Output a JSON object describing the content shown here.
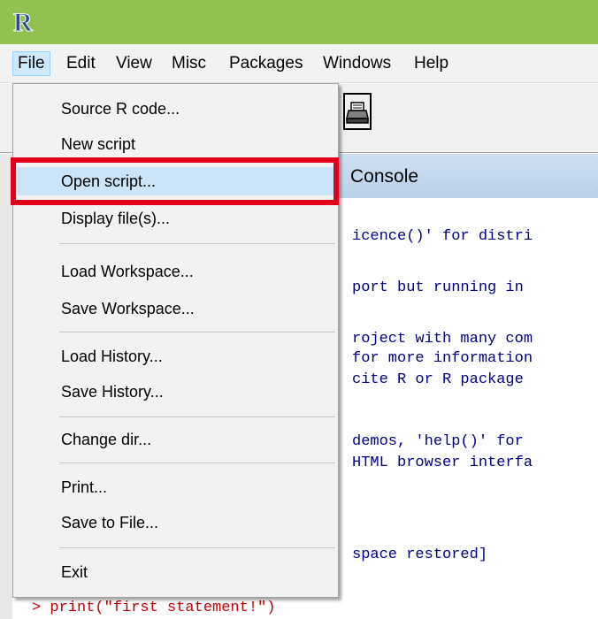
{
  "app": {
    "logo_letter": "R"
  },
  "menubar": {
    "items": [
      "File",
      "Edit",
      "View",
      "Misc",
      "Packages",
      "Windows",
      "Help"
    ],
    "active": "File"
  },
  "toolbar": {
    "print_icon": "printer-icon"
  },
  "console": {
    "title_fragment": "Console",
    "lines": [
      "icence()' for distri",
      "port but running in",
      "roject with many com",
      "for more information",
      "cite R or R package",
      "demos, 'help()' for",
      "HTML browser interfa",
      "space restored]"
    ],
    "prompt": "> print(\"first statement!\")"
  },
  "file_menu": {
    "items": [
      "Source R code...",
      "New script",
      "Open script...",
      "Display file(s)...",
      "Load Workspace...",
      "Save Workspace...",
      "Load History...",
      "Save History...",
      "Change dir...",
      "Print...",
      "Save to File...",
      "Exit"
    ],
    "highlighted": "Open script..."
  },
  "colors": {
    "titlebar": "#92c051",
    "highlight_border": "#e0001b",
    "menu_hover": "#cce4f7",
    "console_text": "#000080",
    "prompt_text": "#c00000"
  }
}
